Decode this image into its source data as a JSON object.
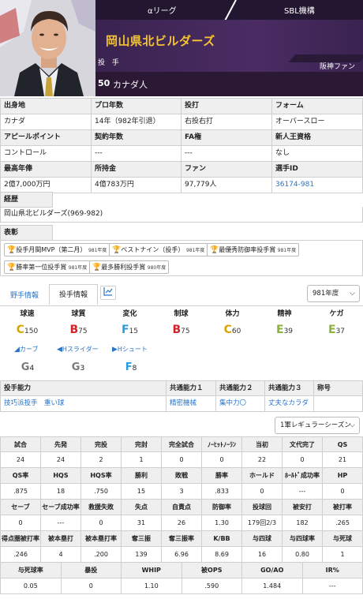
{
  "header": {
    "league": "αリーグ",
    "org": "SBL機構",
    "team": "岡山県北ビルダーズ",
    "position": "投 手",
    "fan_label": "阪神ファン",
    "number": "50",
    "name": "カナダ人",
    "colors": {
      "team_text": "#f5c431",
      "bg": "#2c1a3a"
    }
  },
  "info": {
    "row1": [
      "出身地",
      "プロ年数",
      "投打",
      "フォーム"
    ],
    "row2": [
      "カナダ",
      "14年（982年引退）",
      "右投右打",
      "オーバースロー"
    ],
    "row3": [
      "アピールポイント",
      "契約年数",
      "FA権",
      "新人王資格"
    ],
    "row4": [
      "コントロール",
      "---",
      "---",
      "なし"
    ],
    "row5": [
      "最高年俸",
      "所持金",
      "ファン",
      "選手ID"
    ],
    "row6": [
      "2億7,000万円",
      "4億783万円",
      "97,779人",
      "36174-981"
    ]
  },
  "career": {
    "label": "経歴",
    "value": "岡山県北ビルダーズ(969-982)"
  },
  "awards": {
    "label": "表彰",
    "items": [
      {
        "name": "投手月間MVP（第二月）",
        "year": "981年度"
      },
      {
        "name": "ベストナイン（投手）",
        "year": "981年度"
      },
      {
        "name": "最優秀防御率投手賞",
        "year": "981年度"
      },
      {
        "name": "勝率第一位投手賞",
        "year": "981年度"
      },
      {
        "name": "最多勝利投手賞",
        "year": "980年度"
      }
    ]
  },
  "tabs": {
    "fielder": "野手情報",
    "pitcher": "投手情報",
    "chart_icon": "chart-icon",
    "year_select": "981年度"
  },
  "abilities": {
    "headers": [
      "球速",
      "球質",
      "変化",
      "制球",
      "体力",
      "精神",
      "ケガ"
    ],
    "values": [
      {
        "grade": "C",
        "value": "150"
      },
      {
        "grade": "B",
        "value": "75"
      },
      {
        "grade": "F",
        "value": "15"
      },
      {
        "grade": "B",
        "value": "75"
      },
      {
        "grade": "C",
        "value": "60"
      },
      {
        "grade": "E",
        "value": "39"
      },
      {
        "grade": "E",
        "value": "37"
      }
    ],
    "pitches": [
      {
        "name": "カーブ",
        "grade": "G",
        "value": "4"
      },
      {
        "name": "Hスライダー",
        "grade": "G",
        "value": "3"
      },
      {
        "name": "Hシュート",
        "grade": "F",
        "value": "8"
      }
    ]
  },
  "ability_table": {
    "headers": [
      "投手能力",
      "共通能力１",
      "共通能力２",
      "共通能力３",
      "称号"
    ],
    "values": [
      "技巧派投手　重い球",
      "精密機械",
      "集中力〇",
      "丈夫なカラダ",
      ""
    ]
  },
  "season_select": "1軍レギュラーシーズン",
  "stats": {
    "rows": [
      {
        "h": [
          "試合",
          "先発",
          "完投",
          "完封",
          "完全試合",
          "ﾉｰﾋｯﾄﾉｰﾗﾝ",
          "当初",
          "文代完了",
          "QS"
        ],
        "v": [
          "24",
          "24",
          "2",
          "1",
          "0",
          "0",
          "22",
          "0",
          "21"
        ]
      },
      {
        "h": [
          "QS率",
          "HQS",
          "HQS率",
          "勝利",
          "敗戦",
          "勝率",
          "ホールド",
          "ﾎｰﾙﾄﾞ成功率",
          "HP"
        ],
        "v": [
          ".875",
          "18",
          ".750",
          "15",
          "3",
          ".833",
          "0",
          "---",
          "0"
        ]
      },
      {
        "h": [
          "セーブ",
          "セーブ成功率",
          "救援失敗",
          "失点",
          "自責点",
          "防御率",
          "投球回",
          "被安打",
          "被打率"
        ],
        "v": [
          "0",
          "---",
          "0",
          "31",
          "26",
          "1.30",
          "179回2/3",
          "182",
          ".265"
        ]
      },
      {
        "h": [
          "得点圏被打率",
          "被本塁打",
          "被本塁打率",
          "奪三振",
          "奪三振率",
          "K/BB",
          "与四球",
          "与四球率",
          "与死球"
        ],
        "v": [
          ".246",
          "4",
          ".200",
          "139",
          "6.96",
          "8.69",
          "16",
          "0.80",
          "1"
        ]
      },
      {
        "h": [
          "与死球率",
          "暴投",
          "WHIP",
          "被OPS",
          "GO/AO",
          "IR%"
        ],
        "v": [
          "0.05",
          "0",
          "1.10",
          ".590",
          "1.484",
          "---"
        ]
      }
    ]
  }
}
